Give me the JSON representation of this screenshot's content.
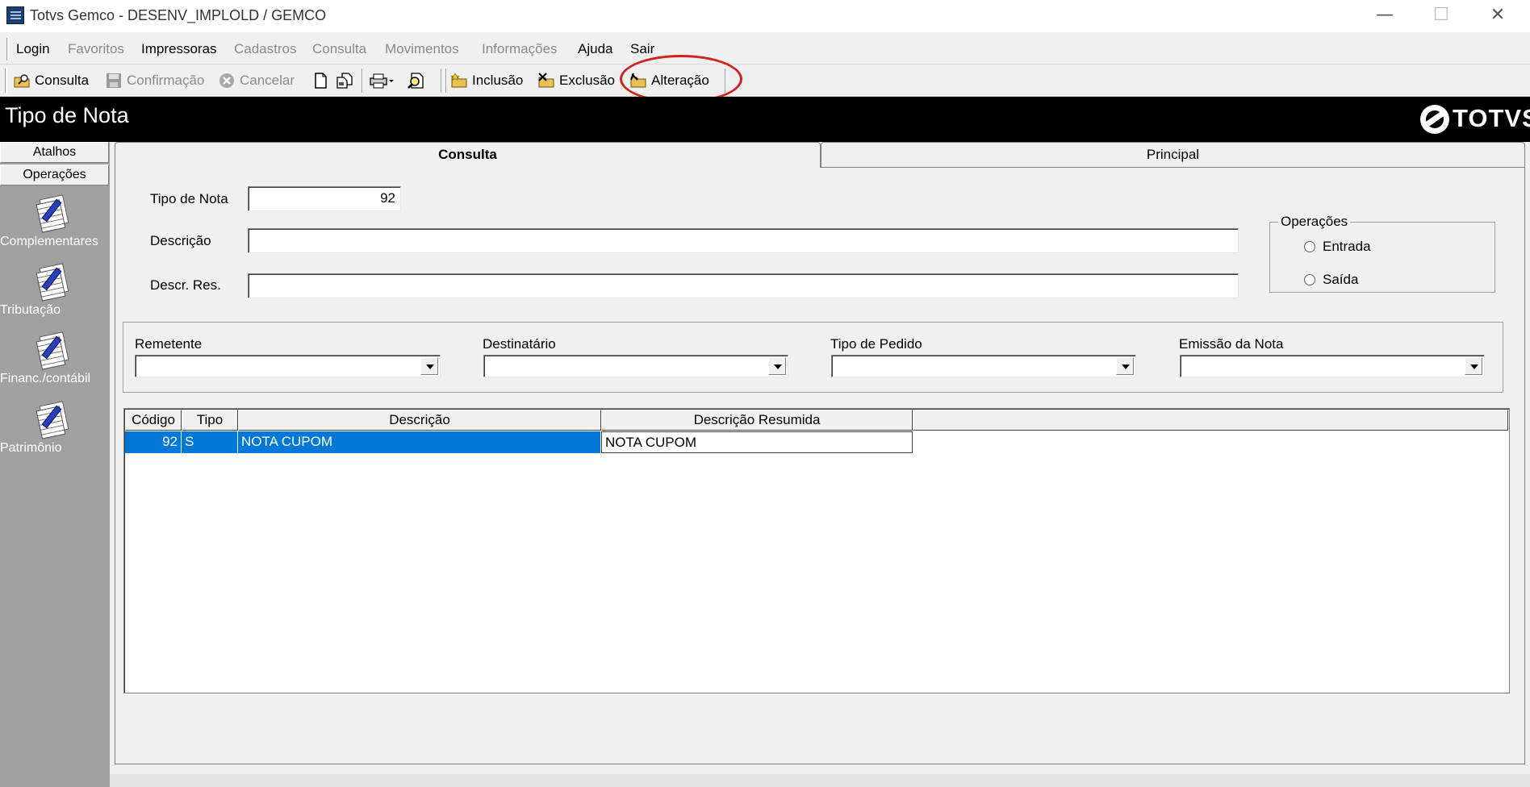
{
  "window": {
    "title": "Totvs Gemco - DESENV_IMPLOLD / GEMCO",
    "minimize_glyph": "—",
    "maximize_glyph": "☐",
    "close_glyph": "✕"
  },
  "menu": {
    "items": [
      {
        "label": "Login",
        "enabled": true
      },
      {
        "label": "Favoritos",
        "enabled": false
      },
      {
        "label": "Impressoras",
        "enabled": true
      },
      {
        "label": "Cadastros",
        "enabled": false
      },
      {
        "label": "Consulta",
        "enabled": false
      },
      {
        "label": "Movimentos",
        "enabled": false
      },
      {
        "label": "Informações",
        "enabled": false
      },
      {
        "label": "Ajuda",
        "enabled": true
      },
      {
        "label": "Sair",
        "enabled": true
      }
    ]
  },
  "toolbar": {
    "consulta": "Consulta",
    "confirmacao": "Confirmação",
    "cancelar": "Cancelar",
    "inclusao": "Inclusão",
    "exclusao": "Exclusão",
    "alteracao": "Alteração",
    "highlight_color": "#d0211c"
  },
  "header": {
    "title": "Tipo de Nota",
    "logo_text": "TOTVS"
  },
  "sidebar": {
    "tabs": [
      "Atalhos",
      "Operações"
    ],
    "items": [
      {
        "label": "Complementares",
        "icon": "document-pen-icon"
      },
      {
        "label": "Tributação",
        "icon": "document-pen-icon"
      },
      {
        "label": "Financ./contábil",
        "icon": "document-pen-icon"
      },
      {
        "label": "Patrimônio",
        "icon": "document-pen-icon"
      }
    ]
  },
  "tabs": {
    "consulta": "Consulta",
    "principal": "Principal"
  },
  "form": {
    "tipo_nota_label": "Tipo de Nota",
    "tipo_nota_value": "92",
    "descricao_label": "Descrição",
    "descricao_value": "",
    "descr_res_label": "Descr. Res.",
    "descr_res_value": ""
  },
  "operacoes": {
    "title": "Operações",
    "entrada": "Entrada",
    "saida": "Saída"
  },
  "filters": {
    "remetente": "Remetente",
    "destinatario": "Destinatário",
    "tipo_pedido": "Tipo de Pedido",
    "emissao_nota": "Emissão da Nota"
  },
  "grid": {
    "columns": [
      "Código",
      "Tipo",
      "Descrição",
      "Descrição Resumida"
    ],
    "rows": [
      {
        "codigo": "92",
        "tipo": "S",
        "descricao": "NOTA CUPOM",
        "descricao_resumida": "NOTA CUPOM"
      }
    ],
    "selection_color": "#0078d7"
  }
}
